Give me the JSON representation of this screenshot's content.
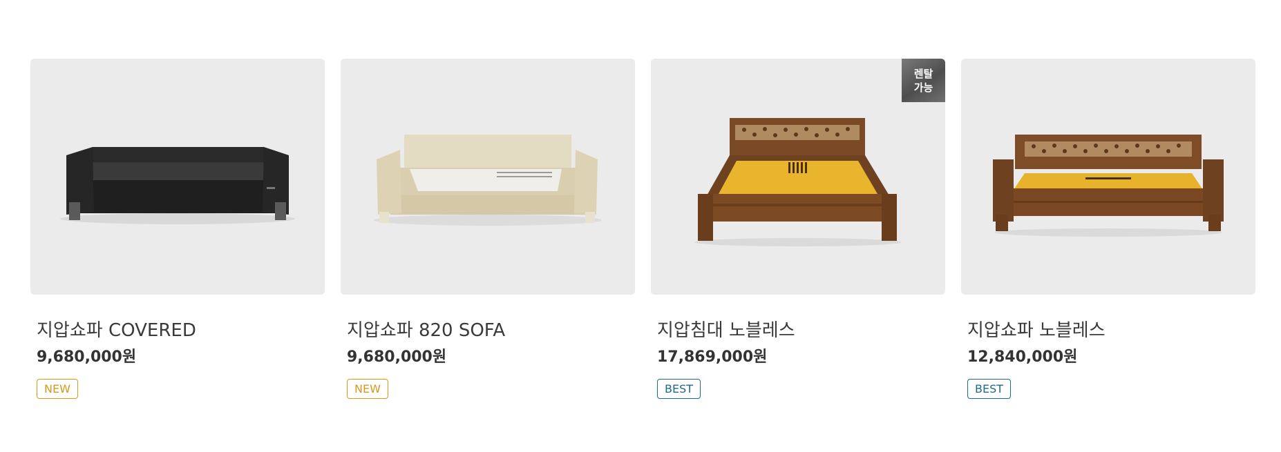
{
  "products": [
    {
      "name": "지압쇼파 COVERED",
      "price": "9,680,000원",
      "badge": "NEW",
      "badge_color": "#d6981c",
      "image_icon": "black-sofa-image",
      "rental": ""
    },
    {
      "name": "지압쇼파 820 SOFA",
      "price": "9,680,000원",
      "badge": "NEW",
      "badge_color": "#d6981c",
      "image_icon": "cream-sofa-image",
      "rental": ""
    },
    {
      "name": "지압침대 노블레스",
      "price": "17,869,000원",
      "badge": "BEST",
      "badge_color": "#1a6b8a",
      "image_icon": "wooden-bed-image",
      "rental": "렌탈\n가능"
    },
    {
      "name": "지압쇼파 노블레스",
      "price": "12,840,000원",
      "badge": "BEST",
      "badge_color": "#1a6b8a",
      "image_icon": "wooden-sofa-image",
      "rental": ""
    }
  ],
  "rental_badge": {
    "line1": "렌탈",
    "line2": "가능"
  }
}
